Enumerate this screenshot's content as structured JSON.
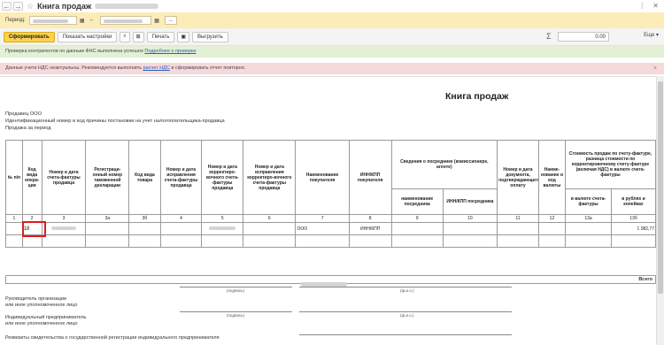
{
  "window": {
    "back_icon": "arrow-left-icon",
    "forward_icon": "arrow-right-icon",
    "title": "Книга продаж",
    "more_icon": "ellipsis-icon",
    "close_icon": "close-icon"
  },
  "period": {
    "label": "Период:",
    "separator": "–",
    "more": "..."
  },
  "toolbar": {
    "generate": "Сформировать",
    "show_settings": "Показать настройки",
    "search_icon": "search-icon",
    "print": "Печать",
    "save_icon": "save-icon",
    "export": "Выгрузить",
    "sigma": "Σ",
    "sum_value": "0.00",
    "more": "Еще ▾"
  },
  "notices": {
    "green_text": "Проверка контрагентов по данным ФНС выполнена успешно ",
    "green_link": "Подробнее о проверке",
    "red_text_1": "Данные учета НДС неактуальны. Рекомендуется выполнить ",
    "red_link": "расчет НДС",
    "red_text_2": " и сформировать отчет повторно.",
    "close": "×"
  },
  "report": {
    "title": "Книга продаж",
    "seller": "Продавец  ООО",
    "inn_line": "Идентификационный номер и код причины постановки на учет налогоплательщика-продавца",
    "period_line": "Продажа за период"
  },
  "table": {
    "headers": {
      "num": "№ п/п",
      "op_code": "Код вида опера-ции",
      "invoice": "Номер и дата счета-фактуры продавца",
      "customs": "Регистраци-онный номер таможенной декларации",
      "goods_code": "Код вида товара",
      "correction": "Номер и дата исправления счета-фактуры продавца",
      "adj_invoice": "Номер и дата корректиро-вочного счета-фактуры продавца",
      "adj_correction": "Номер и дата исправления корректиро-вочного счета-фактуры продавца",
      "buyer": "Наименование покупателя",
      "buyer_inn": "ИНН/КПП покупателя",
      "agent": "Сведения о посреднике (комиссионере, агенте)",
      "agent_name": "наименование посредника",
      "agent_inn": "ИНН/КПП посредника",
      "payment_doc": "Номер и дата документа, подтверждающего оплату",
      "currency": "Наиме-нование и код валюты",
      "total": "Стоимость продаж по счету-фактуре, разница стоимости по корректировочному счету-фактуре (включая НДС) в валюте счета-фактуры",
      "in_currency": "в валюте счета-фактуры",
      "in_rubles": "в рублях и копейках"
    },
    "numbers": [
      "1",
      "2",
      "3",
      "3а",
      "3б",
      "4",
      "5",
      "6",
      "7",
      "8",
      "9",
      "10",
      "11",
      "12",
      "13а",
      "13б"
    ],
    "row": {
      "op_code": "18",
      "buyer": "ООО",
      "buyer_inn": "ИНН/КПП",
      "amount": "1 082,77"
    },
    "total_label": "Всего"
  },
  "signatures": {
    "head_1": "Руководитель организации",
    "head_2": "или иное уполномоченное лицо",
    "entrepreneur_1": "Индивидуальный предприниматель",
    "entrepreneur_2": "или иное уполномоченное лицо",
    "certificate": "Реквизиты свидетельства о государственной регистрации индивидуального предпринимателя",
    "signature_cap": "(подпись)",
    "name_cap": "(ф.и.о.)"
  },
  "colors": {
    "period_bar": "#fbecb8",
    "primary_button": "#fbd24a",
    "notice_green": "#e3f0d4",
    "notice_red": "#f6d9d9",
    "highlight": "#e21b1b"
  }
}
